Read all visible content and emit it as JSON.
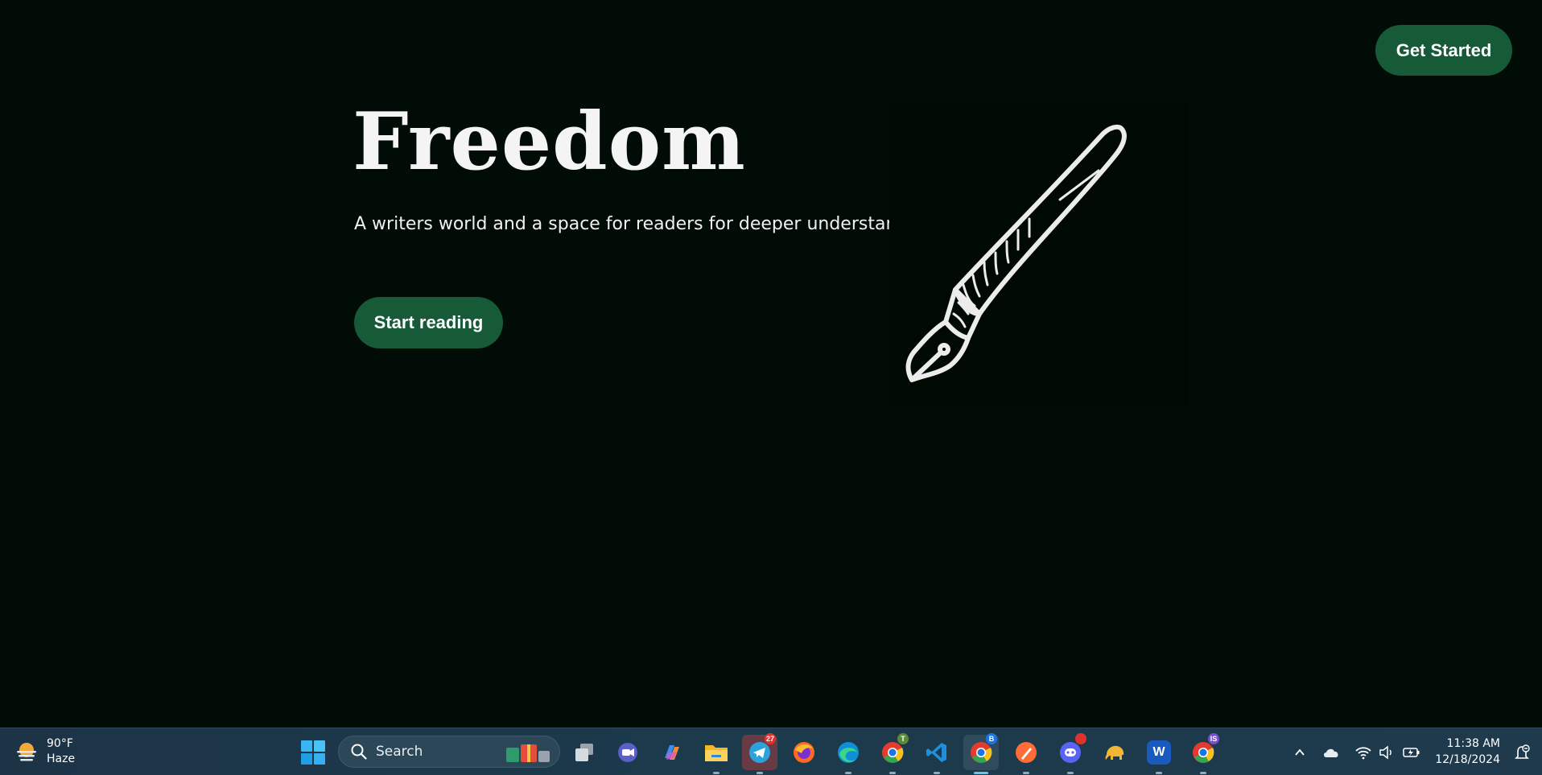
{
  "header": {
    "get_started_label": "Get Started"
  },
  "hero": {
    "title": "Freedom",
    "subtitle": "A writers world and a space for readers for deeper understanding.",
    "cta_label": "Start reading",
    "illustration_icon": "fountain-pen-icon"
  },
  "colors": {
    "background": "#010c06",
    "accent": "#165a38",
    "text": "#f4f4f4"
  },
  "taskbar": {
    "weather": {
      "temperature": "90°F",
      "condition": "Haze",
      "icon": "haze-sun-icon"
    },
    "search": {
      "label": "Search"
    },
    "apps": [
      {
        "name": "task-view",
        "icon": "task-view-icon"
      },
      {
        "name": "teams-meet",
        "icon": "video-chat-icon"
      },
      {
        "name": "copilot",
        "icon": "copilot-icon"
      },
      {
        "name": "file-explorer",
        "icon": "folder-icon"
      },
      {
        "name": "telegram",
        "icon": "telegram-icon",
        "badge": "27"
      },
      {
        "name": "firefox",
        "icon": "firefox-icon"
      },
      {
        "name": "edge",
        "icon": "edge-icon"
      },
      {
        "name": "chrome-profile-t",
        "icon": "chrome-icon",
        "badge": "T"
      },
      {
        "name": "vscode",
        "icon": "vscode-icon"
      },
      {
        "name": "chrome-profile-b",
        "icon": "chrome-icon",
        "badge": "B"
      },
      {
        "name": "postman",
        "icon": "postman-icon"
      },
      {
        "name": "discord",
        "icon": "discord-icon"
      },
      {
        "name": "tableplus",
        "icon": "elephant-icon"
      },
      {
        "name": "word",
        "icon": "word-icon",
        "glyph": "W"
      },
      {
        "name": "chrome-profile-is",
        "icon": "chrome-icon",
        "badge": "IS"
      }
    ],
    "clock": {
      "time": "11:38 AM",
      "date": "12/18/2024"
    }
  }
}
